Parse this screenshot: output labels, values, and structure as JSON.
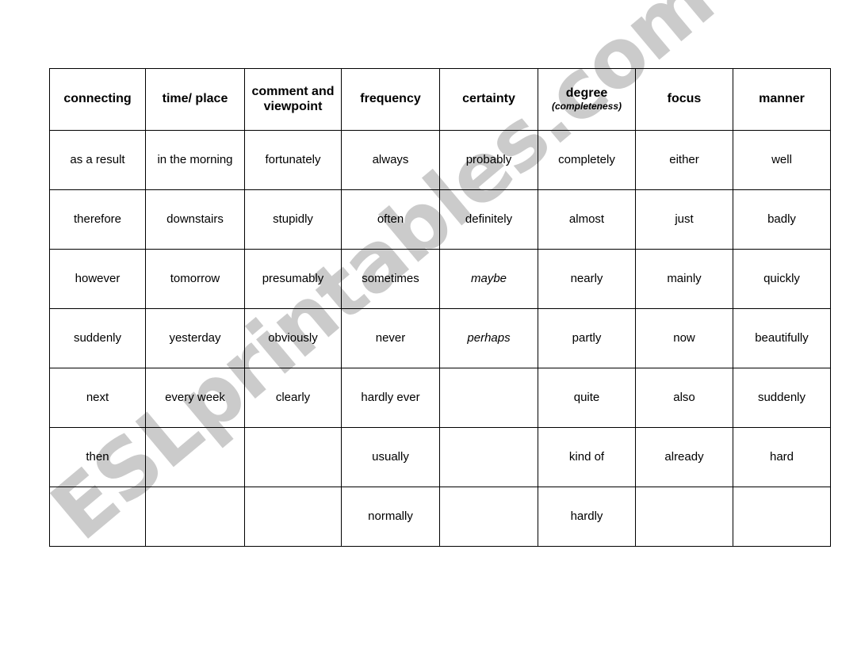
{
  "worksheet": {
    "watermark": "ESLprintables.com",
    "watermark_color": "#cbcbcb",
    "border_color": "#000000",
    "background_color": "#ffffff",
    "text_color": "#000000"
  },
  "table": {
    "headers": [
      {
        "label": "connecting",
        "sub": ""
      },
      {
        "label": "time/ place",
        "sub": ""
      },
      {
        "label": "comment and viewpoint",
        "sub": ""
      },
      {
        "label": "frequency",
        "sub": ""
      },
      {
        "label": "certainty",
        "sub": ""
      },
      {
        "label": "degree",
        "sub": "(completeness)"
      },
      {
        "label": "focus",
        "sub": ""
      },
      {
        "label": "manner",
        "sub": ""
      }
    ],
    "rows": [
      [
        {
          "text": "as a result",
          "italic": false
        },
        {
          "text": "in the morning",
          "italic": false
        },
        {
          "text": "fortunately",
          "italic": false
        },
        {
          "text": "always",
          "italic": false
        },
        {
          "text": "probably",
          "italic": false
        },
        {
          "text": "completely",
          "italic": false
        },
        {
          "text": "either",
          "italic": false
        },
        {
          "text": "well",
          "italic": false
        }
      ],
      [
        {
          "text": "therefore",
          "italic": false
        },
        {
          "text": "downstairs",
          "italic": false
        },
        {
          "text": "stupidly",
          "italic": false
        },
        {
          "text": "often",
          "italic": false
        },
        {
          "text": "definitely",
          "italic": false
        },
        {
          "text": "almost",
          "italic": false
        },
        {
          "text": "just",
          "italic": false
        },
        {
          "text": "badly",
          "italic": false
        }
      ],
      [
        {
          "text": "however",
          "italic": false
        },
        {
          "text": "tomorrow",
          "italic": false
        },
        {
          "text": "presumably",
          "italic": false
        },
        {
          "text": "sometimes",
          "italic": false
        },
        {
          "text": "maybe",
          "italic": true
        },
        {
          "text": "nearly",
          "italic": false
        },
        {
          "text": "mainly",
          "italic": false
        },
        {
          "text": "quickly",
          "italic": false
        }
      ],
      [
        {
          "text": "suddenly",
          "italic": false
        },
        {
          "text": "yesterday",
          "italic": false
        },
        {
          "text": "obviously",
          "italic": false
        },
        {
          "text": "never",
          "italic": false
        },
        {
          "text": "perhaps",
          "italic": true
        },
        {
          "text": "partly",
          "italic": false
        },
        {
          "text": "now",
          "italic": false
        },
        {
          "text": "beautifully",
          "italic": false
        }
      ],
      [
        {
          "text": "next",
          "italic": false
        },
        {
          "text": "every week",
          "italic": false
        },
        {
          "text": "clearly",
          "italic": false
        },
        {
          "text": "hardly ever",
          "italic": false
        },
        {
          "text": "",
          "italic": false
        },
        {
          "text": "quite",
          "italic": false
        },
        {
          "text": "also",
          "italic": false
        },
        {
          "text": "suddenly",
          "italic": false
        }
      ],
      [
        {
          "text": "then",
          "italic": false
        },
        {
          "text": "",
          "italic": false
        },
        {
          "text": "",
          "italic": false
        },
        {
          "text": "usually",
          "italic": false
        },
        {
          "text": "",
          "italic": false
        },
        {
          "text": "kind of",
          "italic": false
        },
        {
          "text": "already",
          "italic": false
        },
        {
          "text": "hard",
          "italic": false
        }
      ],
      [
        {
          "text": "",
          "italic": false
        },
        {
          "text": "",
          "italic": false
        },
        {
          "text": "",
          "italic": false
        },
        {
          "text": "normally",
          "italic": false
        },
        {
          "text": "",
          "italic": false
        },
        {
          "text": "hardly",
          "italic": false
        },
        {
          "text": "",
          "italic": false
        },
        {
          "text": "",
          "italic": false
        }
      ]
    ]
  }
}
